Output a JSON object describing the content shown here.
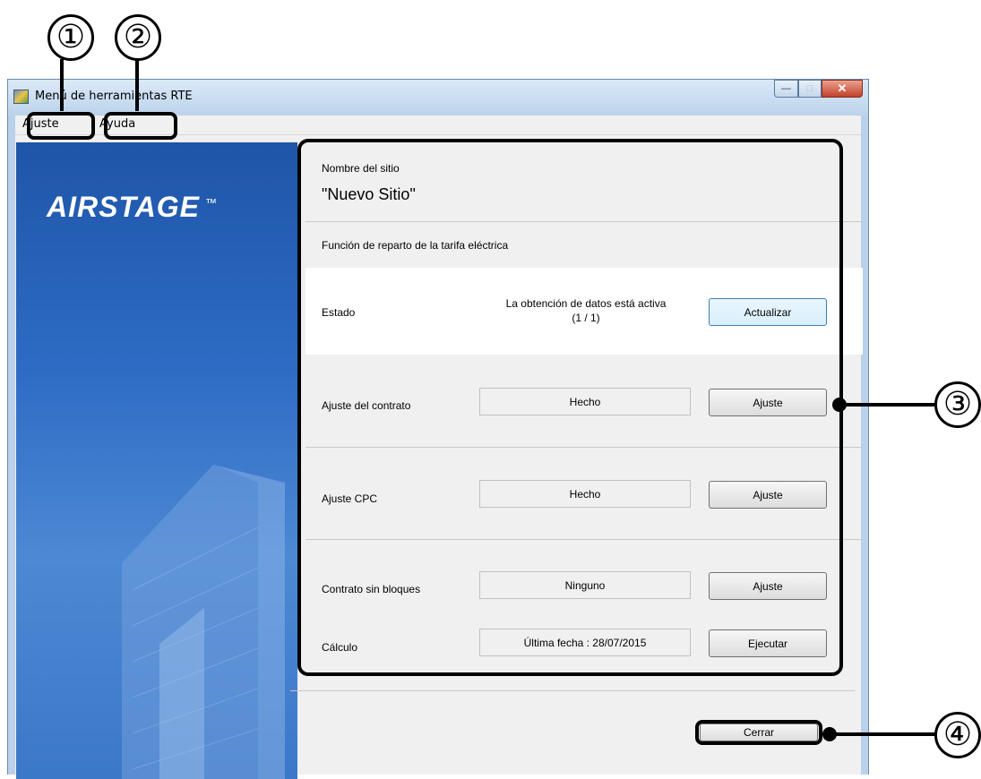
{
  "window": {
    "title": "Menú de herramientas RTE"
  },
  "menu": {
    "items": [
      {
        "label": "Ajuste"
      },
      {
        "label": "Ayuda"
      }
    ]
  },
  "brand": {
    "logo_text": "AIRSTAGE",
    "logo_mark": "™"
  },
  "site": {
    "label": "Nombre del sitio",
    "name": "\"Nuevo Sitio\""
  },
  "billing": {
    "heading": "Función de reparto de la tarifa eléctrica",
    "status": {
      "label": "Estado",
      "text_line1": "La obtención de datos está activa",
      "text_line2": "(1 / 1)",
      "button": "Actualizar"
    },
    "contract": {
      "label": "Ajuste del contrato",
      "value": "Hecho",
      "button": "Ajuste"
    },
    "cpc": {
      "label": "Ajuste CPC",
      "value": "Hecho",
      "button": "Ajuste"
    },
    "noblock": {
      "label": "Contrato sin bloques",
      "value": "Ninguno",
      "button": "Ajuste"
    },
    "calc": {
      "label": "Cálculo",
      "value": "Última fecha : 28/07/2015",
      "button": "Ejecutar"
    }
  },
  "footer": {
    "close_button": "Cerrar"
  },
  "callouts": {
    "c1": "①",
    "c2": "②",
    "c3": "③",
    "c4": "④"
  }
}
